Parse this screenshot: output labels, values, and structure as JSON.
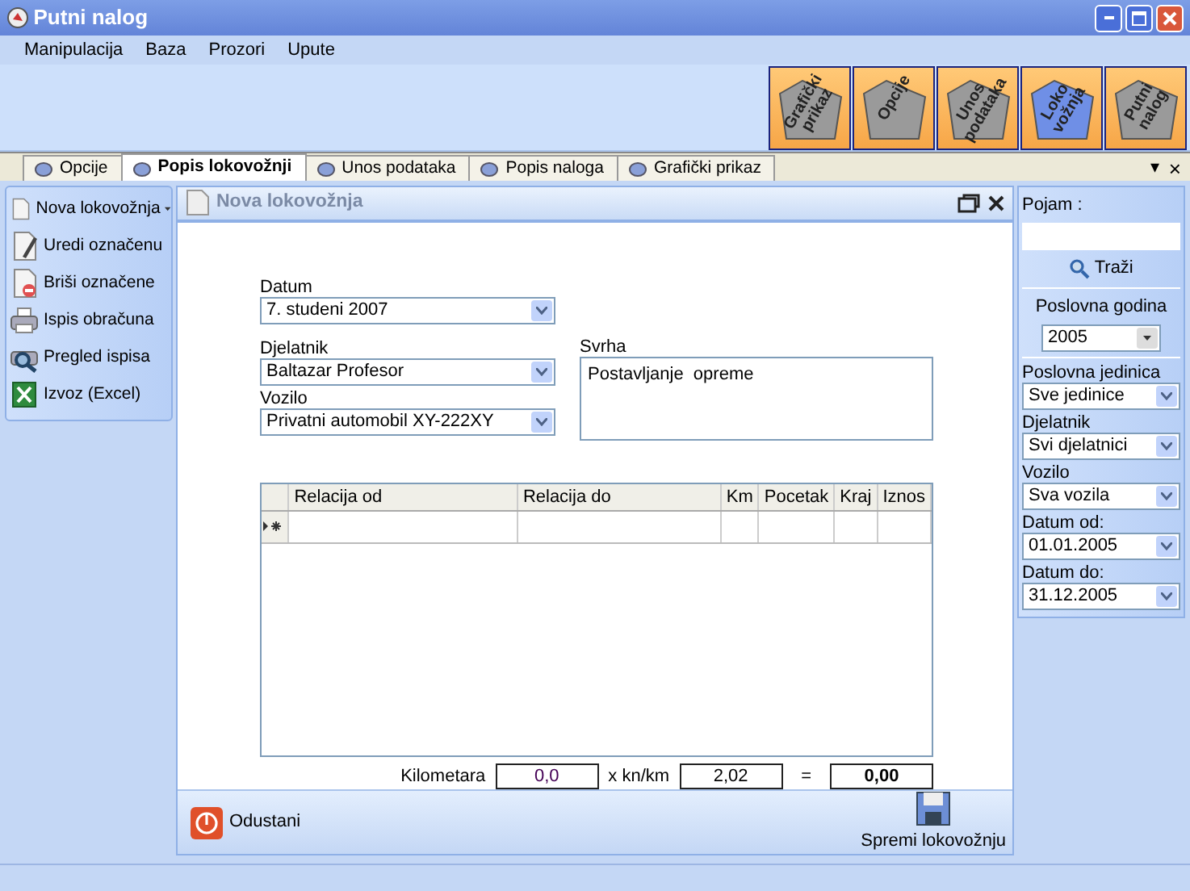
{
  "window": {
    "title": "Putni nalog"
  },
  "menu": [
    "Manipulacija",
    "Baza",
    "Prozori",
    "Upute"
  ],
  "toolbar_buttons": [
    {
      "label": "Grafički prikaz",
      "selected": false
    },
    {
      "label": "Opcije",
      "selected": false
    },
    {
      "label": "Unos podataka",
      "selected": false
    },
    {
      "label": "Loko vožnja",
      "selected": true
    },
    {
      "label": "Putni nalog",
      "selected": false
    }
  ],
  "tabs": [
    {
      "label": "Opcije",
      "selected": false
    },
    {
      "label": "Popis lokovožnji",
      "selected": true
    },
    {
      "label": "Unos podataka",
      "selected": false
    },
    {
      "label": "Popis naloga",
      "selected": false
    },
    {
      "label": "Grafički prikaz",
      "selected": false
    }
  ],
  "tab_menu": "▾",
  "tab_close": "×",
  "actions": [
    {
      "label": "Nova lokovožnja",
      "kind": "new",
      "dropdown": true
    },
    {
      "label": "Uredi označenu",
      "kind": "edit",
      "dropdown": false
    },
    {
      "label": "Briši označene",
      "kind": "delete",
      "dropdown": false
    },
    {
      "label": "Ispis obračuna",
      "kind": "print",
      "dropdown": false
    },
    {
      "label": "Pregled ispisa",
      "kind": "preview",
      "dropdown": false
    },
    {
      "label": "Izvoz (Excel)",
      "kind": "excel",
      "dropdown": false
    }
  ],
  "panel": {
    "title": "Nova lokovožnja",
    "datum": {
      "label": "Datum",
      "value": "7. studeni 2007"
    },
    "djelatnik": {
      "label": "Djelatnik",
      "value": "Baltazar Profesor"
    },
    "vozilo": {
      "label": "Vozilo",
      "value": "Privatni automobil XY-222XY"
    },
    "svrha": {
      "label": "Svrha",
      "value": "Postavljanje  opreme"
    },
    "table": {
      "columns": [
        "Relacija od",
        "Relacija do",
        "Km",
        "Pocetak",
        "Kraj",
        "Iznos"
      ]
    },
    "totals": {
      "label": "Kilometara",
      "km": "0,0",
      "rate_label": "x kn/km",
      "rate": "2,02",
      "equals": "=",
      "total": "0,00"
    },
    "cancel": "Odustani",
    "save": "Spremi lokovožnju"
  },
  "filters": {
    "search_label": "Pojam :",
    "search_button": "Traži",
    "year_label": "Poslovna godina",
    "year": "2005",
    "fields": [
      {
        "label": "Poslovna jedinica",
        "value": "Sve jedinice"
      },
      {
        "label": "Djelatnik",
        "value": "Svi djelatnici"
      },
      {
        "label": "Vozilo",
        "value": "Sva vozila"
      },
      {
        "label": "Datum od:",
        "value": "01.01.2005"
      },
      {
        "label": "Datum do:",
        "value": "31.12.2005"
      }
    ]
  }
}
